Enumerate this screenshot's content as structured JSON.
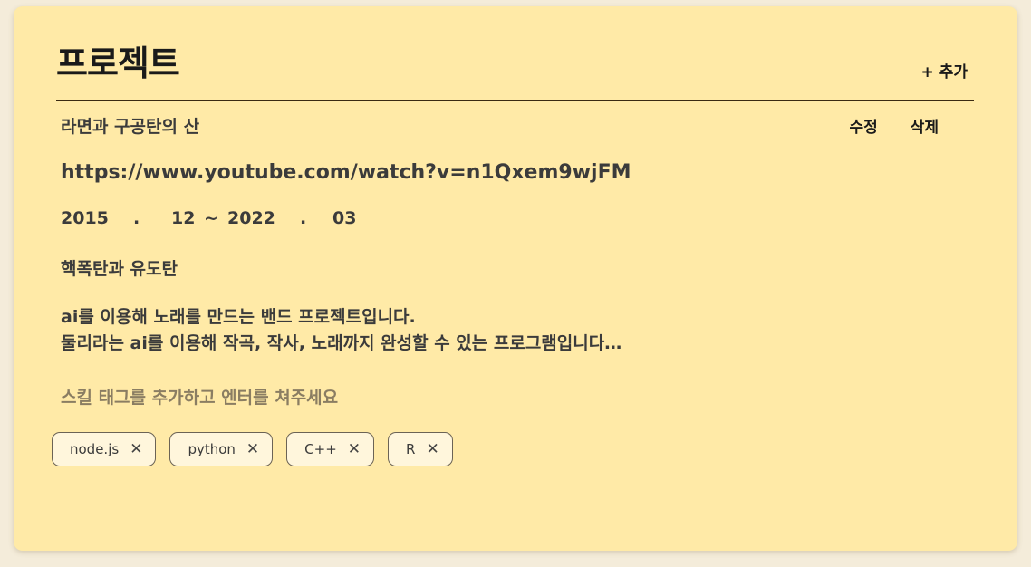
{
  "header": {
    "title": "프로젝트",
    "add_label": "+ 추가"
  },
  "project": {
    "name": "라면과 구공탄의 산",
    "edit_label": "수정",
    "delete_label": "삭제",
    "url": "https://www.youtube.com/watch?v=n1Qxem9wjFM",
    "start_year": "2015",
    "start_month": "12",
    "end_year": "2022",
    "end_month": "03",
    "dot": ".",
    "tilde": "~",
    "role": "핵폭탄과 유도탄",
    "description_line1": "ai를 이용해 노래를 만드는 밴드 프로젝트입니다.",
    "description_line2": "둘리라는 ai를 이용해 작곡, 작사, 노래까지 완성할 수 있는 프로그램입니다…",
    "skill_placeholder": "스킬 태그를 추가하고 엔터를 쳐주세요",
    "tags": [
      {
        "label": "node.js",
        "remove_icon": "close-icon"
      },
      {
        "label": "python",
        "remove_icon": "close-icon"
      },
      {
        "label": "C++",
        "remove_icon": "close-icon"
      },
      {
        "label": "R",
        "remove_icon": "close-icon"
      }
    ]
  },
  "colors": {
    "page_bg": "#f4ecda",
    "card_bg": "#ffeaa7",
    "tag_bg": "#fff6dc",
    "text": "#3b3b3b",
    "heading": "#1a1a1a"
  }
}
